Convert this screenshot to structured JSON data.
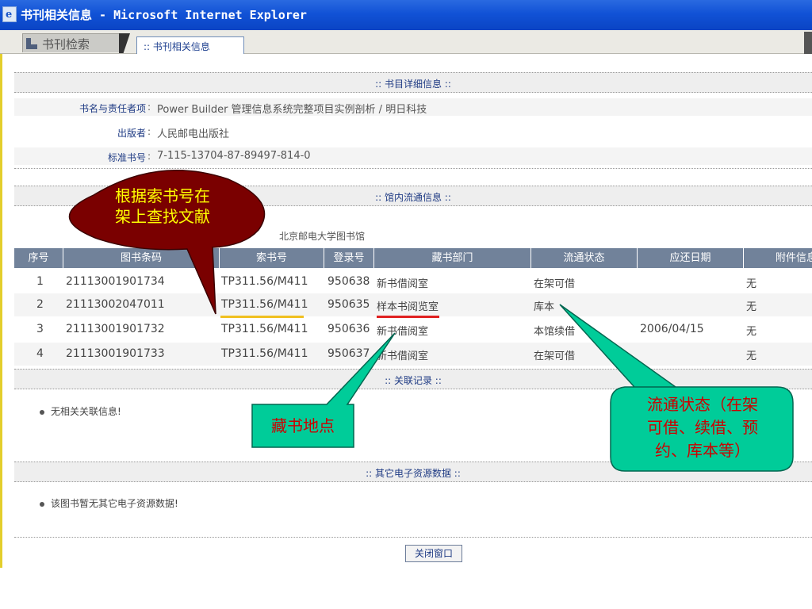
{
  "window": {
    "title": "书刊相关信息 - Microsoft Internet Explorer"
  },
  "tabs": {
    "search_label": "书刊检索",
    "info_label": ":: 书刊相关信息"
  },
  "detail": {
    "section_title": ":: 书目详细信息 ::",
    "rows": [
      {
        "label": "书名与责任者项",
        "value": "Power Builder 管理信息系统完整项目实例剖析 / 明日科技"
      },
      {
        "label": "出版者",
        "value": "人民邮电出版社"
      },
      {
        "label": "标准书号",
        "value": "7-115-13704-87-89497-814-0"
      }
    ]
  },
  "circulation": {
    "section_title": ":: 馆内流通信息 ::",
    "library_name": "北京邮电大学图书馆",
    "columns": [
      "序号",
      "图书条码",
      "索书号",
      "登录号",
      "藏书部门",
      "流通状态",
      "应还日期",
      "附件信息"
    ],
    "rows": [
      [
        "1",
        "21113001901734",
        "TP311.56/M411",
        "950638",
        "新书借阅室",
        "在架可借",
        "",
        "无"
      ],
      [
        "2",
        "21113002047011",
        "TP311.56/M411",
        "950635",
        "样本书阅览室",
        "库本",
        "",
        "无"
      ],
      [
        "3",
        "21113001901732",
        "TP311.56/M411",
        "950636",
        "新书借阅室",
        "本馆续借",
        "2006/04/15",
        "无"
      ],
      [
        "4",
        "21113001901733",
        "TP311.56/M411",
        "950637",
        "新书借阅室",
        "在架可借",
        "",
        "无"
      ]
    ]
  },
  "related": {
    "section_title": ":: 关联记录 ::",
    "message": "无相关关联信息!"
  },
  "eresources": {
    "section_title": ":: 其它电子资源数据 ::",
    "message": "该图书暂无其它电子资源数据!"
  },
  "close_button_label": "关闭窗口",
  "callouts": {
    "call_number": "根据索书号在架上查找文献",
    "call_number_line1": "根据索书号在",
    "call_number_line2": "架上查找文献",
    "location": "藏书地点",
    "status": "流通状态（在架可借、续借、预约、库本等）",
    "status_line1": "流通状态（在架",
    "status_line2": "可借、续借、预",
    "status_line3": "约、库本等）"
  },
  "colors": {
    "titlebar": "#1152d6",
    "table_header": "#71829a",
    "callout_red": "#7a0000",
    "callout_green": "#00cc99",
    "callout_text_yellow": "#ffff00",
    "callout_text_red": "#cc0000",
    "underline_yellow": "#f0c020",
    "underline_red": "#e02020"
  },
  "icons": {
    "window_icon": "ie-page-icon",
    "tab_icon": "arrow-down-right-icon"
  }
}
